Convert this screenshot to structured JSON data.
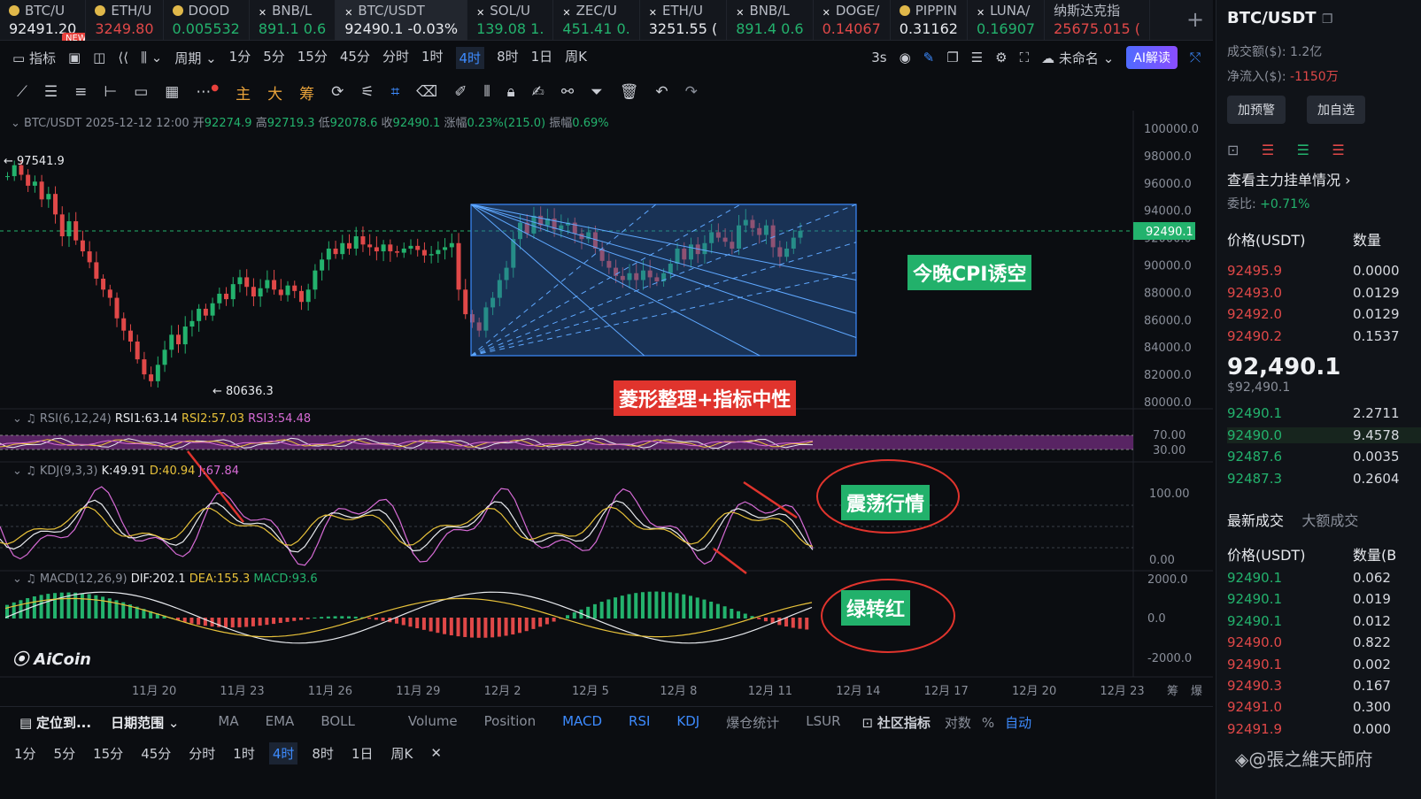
{
  "tickers": [
    {
      "name": "BTC/U",
      "price": "92491.20",
      "color": "#e8eaee",
      "icon": "bitcoin-icon",
      "badge": "NEW"
    },
    {
      "name": "ETH/U",
      "price": "3249.80",
      "color": "#e04848",
      "icon": "ethereum-icon"
    },
    {
      "name": "DOOD",
      "price": "0.005532",
      "color": "#23b26d",
      "icon": "dood-icon"
    },
    {
      "name": "BNB/L",
      "price": "891.1 0.6",
      "color": "#23b26d",
      "icon": "exchange-icon"
    },
    {
      "name": "BTC/USDT",
      "price": "92490.1  -0.03%",
      "color": "#e8eaee",
      "icon": "exchange-icon",
      "active": true
    },
    {
      "name": "SOL/U",
      "price": "139.08 1.",
      "color": "#23b26d",
      "icon": "exchange-icon"
    },
    {
      "name": "ZEC/U",
      "price": "451.41 0.",
      "color": "#23b26d",
      "icon": "exchange-icon"
    },
    {
      "name": "ETH/U",
      "price": "3251.55 (",
      "color": "#e8eaee",
      "icon": "exchange-icon"
    },
    {
      "name": "BNB/L",
      "price": "891.4 0.6",
      "color": "#23b26d",
      "icon": "exchange-icon"
    },
    {
      "name": "DOGE/",
      "price": "0.14067",
      "color": "#e04848",
      "icon": "exchange-icon"
    },
    {
      "name": "PIPPIN",
      "price": "0.31162",
      "color": "#e8eaee",
      "icon": "pippin-icon"
    },
    {
      "name": "LUNA/",
      "price": "0.16907",
      "color": "#23b26d",
      "icon": "exchange-icon"
    },
    {
      "name": "纳斯达克指",
      "price": "25675.015 (",
      "color": "#e04848",
      "icon": ""
    }
  ],
  "toolbar": {
    "indicator": "指标",
    "period": "周期",
    "intervals": [
      "1分",
      "5分",
      "15分",
      "45分",
      "分时",
      "1时",
      "4时",
      "8时",
      "1日",
      "周K"
    ],
    "active_interval": "4时",
    "refresh": "3s",
    "unnamed": "未命名",
    "ai": "AI解读"
  },
  "drawing_tools": {
    "main": "主",
    "big": "大",
    "chips": "筹"
  },
  "ohlc": {
    "symbol": "BTC/USDT",
    "time": "2025-12-12 12:00",
    "open_label": "开",
    "open": "92274.9",
    "high_label": "高",
    "high": "92719.3",
    "low_label": "低",
    "low": "92078.6",
    "close_label": "收",
    "close": "92490.1",
    "change_label": "涨幅",
    "change": "0.23%(215.0)",
    "amp_label": "振幅",
    "amp": "0.69%"
  },
  "price_axis": [
    "100000.0",
    "98000.0",
    "96000.0",
    "94000.0",
    "92000.0",
    "90000.0",
    "88000.0",
    "86000.0",
    "84000.0",
    "82000.0",
    "80000.0"
  ],
  "current_price_tag": "92490.1",
  "marks": {
    "high": "97541.9",
    "low": "80636.3"
  },
  "annotations": {
    "cpi": "今晚CPI诱空",
    "diamond": "菱形整理+指标中性",
    "oscillate": "震荡行情",
    "green_red": "绿转红"
  },
  "rsi": {
    "label": "RSI(6,12,24)",
    "rsi1": "RSI1:63.14",
    "rsi2": "RSI2:57.03",
    "rsi3": "RSI3:54.48",
    "levels": [
      "70.00",
      "30.00"
    ]
  },
  "kdj": {
    "label": "KDJ(9,3,3)",
    "k": "K:49.91",
    "d": "D:40.94",
    "j": "J:67.84",
    "levels": [
      "100.00",
      "0.00"
    ]
  },
  "macd": {
    "label": "MACD(12,26,9)",
    "dif": "DIF:202.1",
    "dea": "DEA:155.3",
    "macd": "MACD:93.6",
    "levels": [
      "2000.0",
      "0.0",
      "-2000.0"
    ]
  },
  "date_axis": [
    "11月 20",
    "11月 23",
    "11月 26",
    "11月 29",
    "12月 2",
    "12月 5",
    "12月 8",
    "12月 11",
    "12月 14",
    "12月 17",
    "12月 20",
    "12月 23"
  ],
  "date_axis_right": [
    "筹",
    "爆"
  ],
  "logo": "AiCoin",
  "bottom_tabs": {
    "locate": "定位到...",
    "range": "日期范围",
    "indicators": [
      "MA",
      "EMA",
      "BOLL",
      "Volume",
      "Position",
      "MACD",
      "RSI",
      "KDJ",
      "爆仓统计",
      "LSUR"
    ],
    "active_indicators": [
      "MACD",
      "RSI",
      "KDJ"
    ],
    "community": "社区指标",
    "log": "对数",
    "percent": "%",
    "auto": "自动"
  },
  "bottom_intervals": [
    "1分",
    "5分",
    "15分",
    "45分",
    "分时",
    "1时",
    "4时",
    "8时",
    "1日",
    "周K"
  ],
  "right_panel": {
    "symbol": "BTC/USDT",
    "volume_label": "成交额($):",
    "volume": "1.2亿",
    "inflow_label": "净流入($):",
    "inflow": "-1150万",
    "alert_btn": "加预警",
    "watch_btn": "加自选",
    "main_orders": "查看主力挂单情况",
    "ratio_label": "委比:",
    "ratio": "+0.71%",
    "col_price": "价格(USDT)",
    "col_qty": "数量",
    "asks": [
      [
        "92495.9",
        "0.0000"
      ],
      [
        "92493.0",
        "0.0129"
      ],
      [
        "92492.0",
        "0.0129"
      ],
      [
        "92490.2",
        "0.1537"
      ]
    ],
    "last_price": "92,490.1",
    "last_usd": "$92,490.1",
    "bids": [
      [
        "92490.1",
        "2.2711"
      ],
      [
        "92490.0",
        "9.4578"
      ],
      [
        "92487.6",
        "0.0035"
      ],
      [
        "92487.3",
        "0.2604"
      ]
    ],
    "trades_tab": "最新成交",
    "big_trades_tab": "大额成交",
    "trades_col_price": "价格(USDT)",
    "trades_col_qty": "数量(B",
    "trades": [
      [
        "92490.1",
        "0.062",
        "g"
      ],
      [
        "92490.1",
        "0.019",
        "g"
      ],
      [
        "92490.1",
        "0.012",
        "g"
      ],
      [
        "92490.0",
        "0.822",
        "r"
      ],
      [
        "92490.1",
        "0.002",
        "r"
      ],
      [
        "92490.3",
        "0.167",
        "r"
      ],
      [
        "92491.0",
        "0.300",
        "r"
      ],
      [
        "92491.9",
        "0.000",
        "r"
      ]
    ],
    "watermark": "@張之維天師府"
  }
}
